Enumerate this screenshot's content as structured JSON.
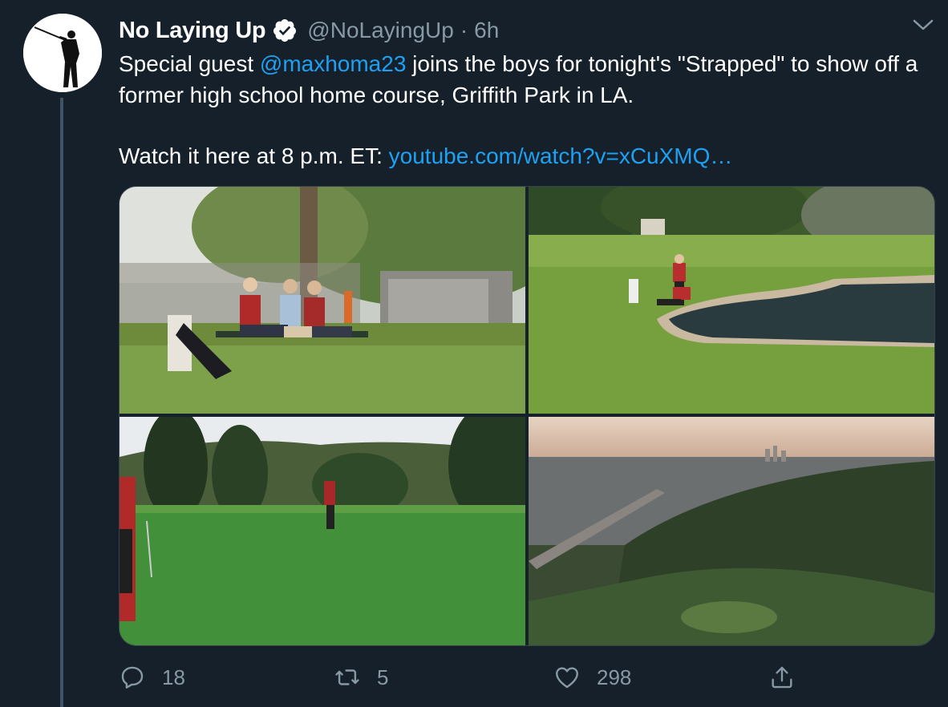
{
  "tweet": {
    "display_name": "No Laying Up",
    "handle": "@NoLayingUp",
    "separator": "·",
    "time": "6h",
    "text_part1": "Special guest ",
    "mention": "@maxhoma23",
    "text_part2": " joins the boys for tonight's \"Strapped\" to show off a former high school home course, Griffith Park in LA.",
    "text_part3": "Watch it here at 8 p.m. ET: ",
    "link": "youtube.com/watch?v=xCuXMQ…"
  },
  "media": {
    "photos": [
      "golfers-on-bench",
      "golfers-by-pond",
      "golfer-on-green",
      "aerial-city-view"
    ]
  },
  "actions": {
    "reply_count": "18",
    "retweet_count": "5",
    "like_count": "298"
  },
  "icons": {
    "verified": "verified-badge-icon",
    "caret": "chevron-down-icon",
    "reply": "reply-icon",
    "retweet": "retweet-icon",
    "like": "heart-icon",
    "share": "share-icon"
  },
  "colors": {
    "background": "#15202b",
    "accent": "#1da1f2",
    "secondary_text": "#8899a6"
  }
}
